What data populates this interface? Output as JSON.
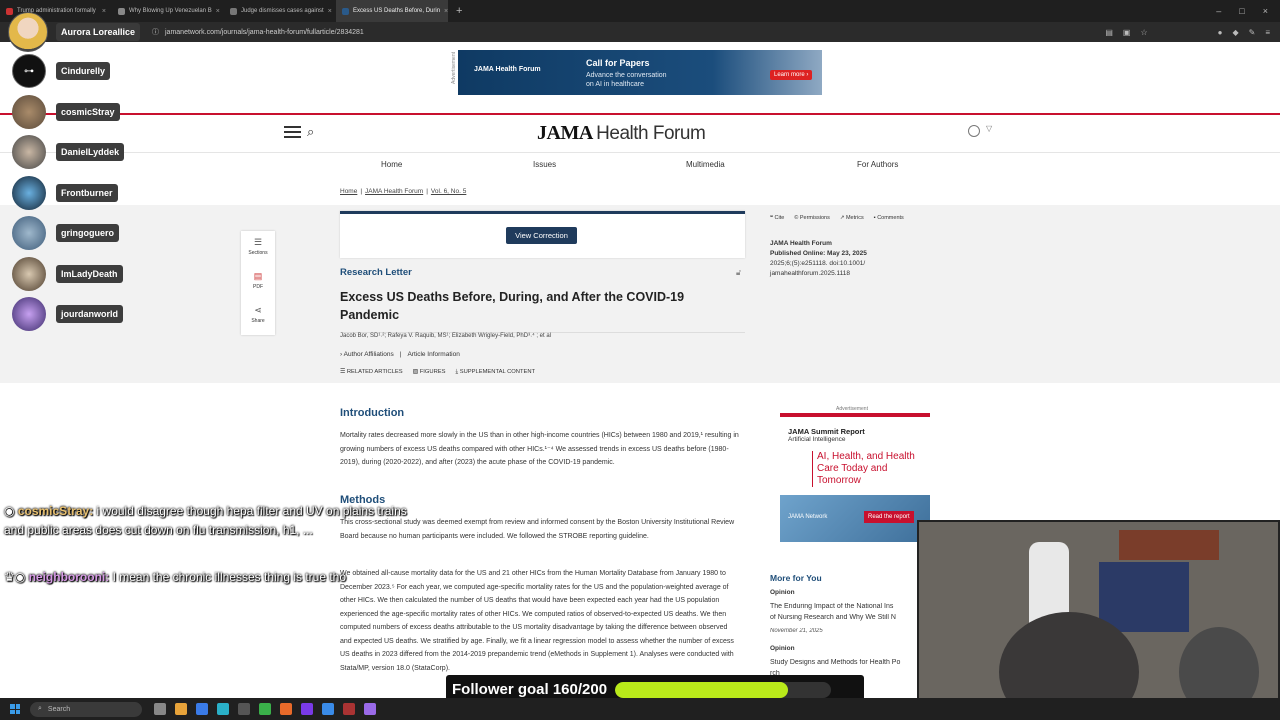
{
  "browser": {
    "tabs": [
      {
        "title": "Trump administration formally"
      },
      {
        "title": "Why Blowing Up Venezuelan B"
      },
      {
        "title": "Judge dismisses cases against"
      },
      {
        "title": "Excess US Deaths Before, Durin"
      }
    ],
    "new_tab": "+",
    "url": "jamanetwork.com/journals/jama-health-forum/fullarticle/2834281"
  },
  "ad_top": {
    "label": "Advertisement",
    "logo": "JAMA Health Forum",
    "title": "Call for Papers",
    "subtitle": "Advance the conversation on AI in healthcare",
    "cta": "Learn more ›"
  },
  "masthead": {
    "brand_main": "JAMA",
    "brand_sub": "Health Forum"
  },
  "nav": [
    "Home",
    "Issues",
    "Multimedia",
    "For Authors"
  ],
  "breadcrumb": [
    "Home",
    "|",
    "JAMA Health Forum",
    "|",
    "Vol. 6, No. 5"
  ],
  "side_tools": [
    {
      "label": "Sections",
      "glyph": "☰"
    },
    {
      "label": "PDF",
      "glyph": "▤"
    },
    {
      "label": "Share",
      "glyph": "⋖"
    }
  ],
  "article": {
    "correction_button": "View Correction",
    "type": "Research Letter",
    "title": "Excess US Deaths Before, During, and After the COVID-19 Pandemic",
    "authors": "Jacob Bor, SD¹˒²; Rafeya V. Raquib, MS¹; Elizabeth Wrigley-Field, PhD³˒⁴ ; et al",
    "affil_link": "Author Affiliations",
    "info_link": "Article Information",
    "related": "RELATED ARTICLES",
    "figures": "FIGURES",
    "supplemental": "SUPPLEMENTAL CONTENT",
    "intro_heading": "Introduction",
    "intro_text": "Mortality rates decreased more slowly in the US than in other high-income countries (HICs) between 1980 and 2019,¹ resulting in growing numbers of excess US deaths compared with other HICs.¹⁻⁴ We assessed trends in excess US deaths before (1980-2019), during (2020-2022), and after (2023) the acute phase of the COVID-19 pandemic.",
    "methods_heading": "Methods",
    "methods_p1": "This cross-sectional study was deemed exempt from review and informed consent by the Boston University Institutional Review Board because no human participants were included. We followed the STROBE reporting guideline.",
    "methods_p2": "We obtained all-cause mortality data for the US and 21 other HICs from the Human Mortality Database from January 1980 to December 2023.⁵ For each year, we computed age-specific mortality rates for the US and the population-weighted average of other HICs. We then calculated the number of US deaths that would have been expected each year had the US population experienced the age-specific mortality rates of other HICs. We computed ratios of observed-to-expected US deaths. We then computed numbers of excess deaths attributable to the US mortality disadvantage by taking the difference between observed and expected US deaths. We stratified by age. Finally, we fit a linear regression model to assess whether the number of excess US deaths in 2023 differed from the 2014-2019 prepandemic trend (eMethods in Supplement 1). Analyses were conducted with Stata/MP, version 18.0 (StataCorp)."
  },
  "meta": {
    "cite": "Cite",
    "permissions": "Permissions",
    "metrics": "Metrics",
    "comments": "Comments",
    "journal": "JAMA Health Forum",
    "published": "Published Online: May 23, 2025",
    "citation": "2025;6;(5):e251118. doi:10.1001/",
    "doi2": "jamahealthforum.2025.1118"
  },
  "side_ad": {
    "label": "Advertisement",
    "line1": "JAMA Summit Report",
    "line2": "Artificial Intelligence",
    "headline": "AI, Health, and Health Care Today and Tomorrow",
    "logo": "JAMA Network",
    "cta": "Read the report"
  },
  "more_for_you": {
    "heading": "More for You",
    "items": [
      {
        "category": "Opinion",
        "title": "The Enduring Impact of the National Ins",
        "title2": "of Nursing Research and Why We Still N",
        "date": "November 21, 2025"
      },
      {
        "category": "Opinion",
        "title": "Study Designs and Methods for Health Po",
        "title2": "rch"
      }
    ]
  },
  "stream": {
    "streamer": "Aurora Loreallice",
    "viewers": [
      "Cindurelly",
      "cosmicStray",
      "DanielLyddek",
      "Frontburner",
      "gringoguero",
      "ImLadyDeath",
      "jourdanworld"
    ],
    "chat": [
      {
        "user": "cosmicStray:",
        "message": "i would disagree though hepa filter and UV on plains trains and public areas does cut down on flu transmission, h1, ..."
      },
      {
        "user": "neighborooni:",
        "message": "I mean the chronic illnesses thing is true tho"
      }
    ],
    "follower_goal_text": "Follower goal 160/200",
    "follower_progress": 0.8
  },
  "taskbar": {
    "search": "Search"
  },
  "colors": {
    "accent": "#1f4e79",
    "brand_red": "#c8102e",
    "progress": "#b9ea1a"
  }
}
